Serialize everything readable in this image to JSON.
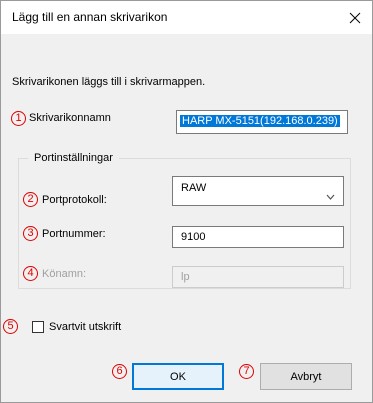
{
  "window": {
    "title": "Lägg till en annan skrivarikon"
  },
  "description": "Skrivarikonen läggs till i skrivarmappen.",
  "printer_name": {
    "label": "Skrivarikonnamn",
    "value": "HARP MX-5151(192.168.0.239)"
  },
  "port_settings": {
    "title": "Portinställningar",
    "protocol": {
      "label": "Portprotokoll:",
      "value": "RAW"
    },
    "port_number": {
      "label": "Portnummer:",
      "value": "9100"
    },
    "queue_name": {
      "label": "Könamn:",
      "value": "lp"
    }
  },
  "monochrome": {
    "label": "Svartvit utskrift",
    "checked": false
  },
  "buttons": {
    "ok": "OK",
    "cancel": "Avbryt"
  },
  "markers": [
    "1",
    "2",
    "3",
    "4",
    "5",
    "6",
    "7"
  ],
  "colors": {
    "marker": "#e00000",
    "selection": "#0078d7"
  }
}
